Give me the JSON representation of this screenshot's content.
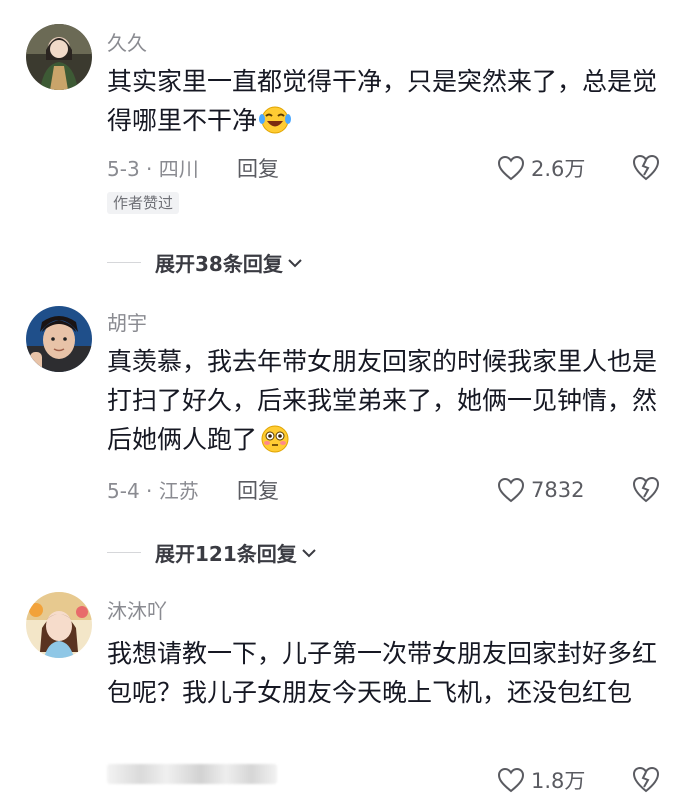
{
  "comments": [
    {
      "username": "久久",
      "text": "其实家里一直都觉得干净，只是突然来了，总是觉得哪里不干净",
      "emoji": "laughing-tears-emoji",
      "meta": "5-3 · 四川",
      "reply_label": "回复",
      "likes": "2.6万",
      "badge": "作者赞过",
      "expand_label": "展开38条回复"
    },
    {
      "username": "胡宇",
      "text": "真羡慕，我去年带女朋友回家的时候我家里人也是打扫了好久，后来我堂弟来了，她俩一见钟情，然后她俩人跑了",
      "emoji": "flushed-emoji",
      "meta": "5-4 · 江苏",
      "reply_label": "回复",
      "likes": "7832",
      "expand_label": "展开121条回复"
    },
    {
      "username": "沐沐吖",
      "text": "我想请教一下，儿子第一次带女朋友回家封好多红包呢？我儿子女朋友今天晚上飞机，还没包红包",
      "likes": "1.8万"
    }
  ],
  "icons": {
    "like": "heart-outline-icon",
    "dislike": "broken-heart-icon",
    "expand": "chevron-down-icon"
  },
  "colors": {
    "text_primary": "#161823",
    "text_secondary": "#8a8b91"
  }
}
